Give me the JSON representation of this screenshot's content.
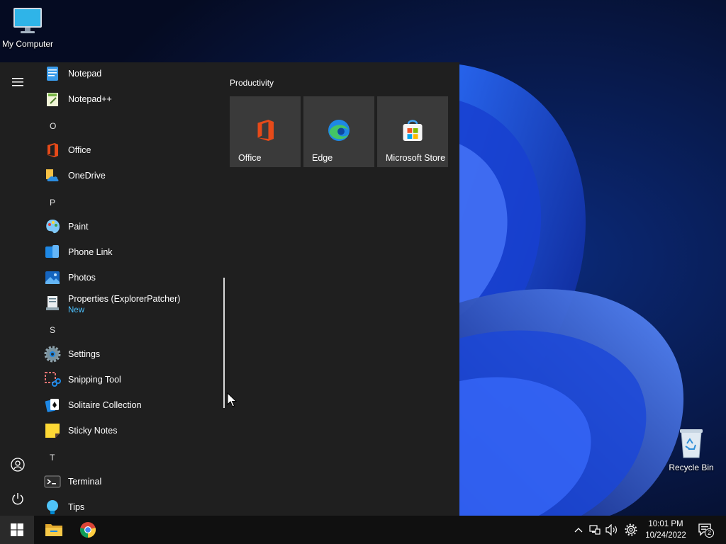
{
  "desktop": {
    "icons": [
      {
        "label": "My Computer",
        "icon": "monitor-icon"
      },
      {
        "label": "Recycle Bin",
        "icon": "recycle-bin-icon"
      }
    ]
  },
  "start_menu": {
    "apps": [
      {
        "label": "Notepad",
        "icon": "notepad-icon"
      },
      {
        "label": "Notepad++",
        "icon": "notepad-plus-plus-icon"
      },
      {
        "letter": "O"
      },
      {
        "label": "Office",
        "icon": "office-icon"
      },
      {
        "label": "OneDrive",
        "icon": "onedrive-icon"
      },
      {
        "letter": "P"
      },
      {
        "label": "Paint",
        "icon": "paint-icon"
      },
      {
        "label": "Phone Link",
        "icon": "phone-link-icon"
      },
      {
        "label": "Photos",
        "icon": "photos-icon"
      },
      {
        "label": "Properties (ExplorerPatcher)",
        "sub": "New",
        "icon": "properties-icon"
      },
      {
        "letter": "S"
      },
      {
        "label": "Settings",
        "icon": "settings-icon"
      },
      {
        "label": "Snipping Tool",
        "icon": "snipping-tool-icon"
      },
      {
        "label": "Solitaire Collection",
        "icon": "solitaire-icon"
      },
      {
        "label": "Sticky Notes",
        "icon": "sticky-notes-icon"
      },
      {
        "letter": "T"
      },
      {
        "label": "Terminal",
        "icon": "terminal-icon"
      },
      {
        "label": "Tips",
        "icon": "tips-icon"
      }
    ],
    "group_title": "Productivity",
    "tiles": [
      {
        "label": "Office",
        "icon": "office-icon"
      },
      {
        "label": "Edge",
        "icon": "edge-icon"
      },
      {
        "label": "Microsoft Store",
        "icon": "microsoft-store-icon"
      }
    ]
  },
  "taskbar": {
    "pinned": [
      {
        "name": "file-explorer",
        "icon": "folder-icon"
      },
      {
        "name": "chrome",
        "icon": "chrome-icon"
      }
    ],
    "clock": {
      "time": "10:01 PM",
      "date": "10/24/2022"
    },
    "notification_count": "2"
  },
  "colors": {
    "accent_link": "#4cc2ff",
    "menu_bg": "#1f1f1f",
    "tile_bg": "#3a3a3a",
    "taskbar_bg": "#101010"
  }
}
